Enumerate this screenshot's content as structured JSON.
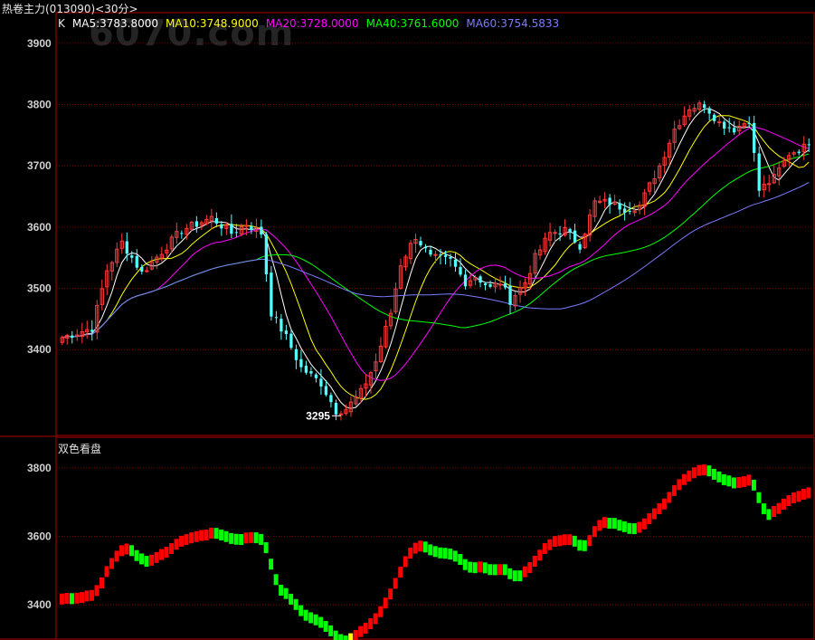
{
  "header": {
    "title": "热卷主力(013090)<30分>"
  },
  "watermark": "6070.com",
  "legend": [
    {
      "label": "K",
      "color": "#e8e8e8"
    },
    {
      "label": "MA5:3783.8000",
      "color": "#ffffff"
    },
    {
      "label": "MA10:3748.9000",
      "color": "#ffff00"
    },
    {
      "label": "MA20:3728.0000",
      "color": "#ff00ff"
    },
    {
      "label": "MA40:3761.6000",
      "color": "#00ff00"
    },
    {
      "label": "MA60:3754.5833",
      "color": "#7b7bff"
    }
  ],
  "sub_panel": {
    "title": "双色看盘"
  },
  "colors": {
    "up": "#ff3a3a",
    "down": "#54ffff",
    "grid": "#7a0000",
    "frame": "#b00000",
    "axis_text": "#d0d0d0",
    "bar_red": "#ff0000",
    "bar_green": "#00ff00",
    "bar_yellow": "#ffff00"
  },
  "chart_data": [
    {
      "type": "candlestick",
      "title": "热卷主力(013090)<30分>",
      "yticks": [
        3400,
        3500,
        3600,
        3700,
        3800,
        3900
      ],
      "ylim": [
        3260,
        3950
      ],
      "annotations": [
        {
          "text": "3295",
          "value": 3295
        }
      ],
      "grid": true,
      "close_anchors": [
        [
          0,
          3420
        ],
        [
          6,
          3435
        ],
        [
          9,
          3530
        ],
        [
          12,
          3575
        ],
        [
          16,
          3525
        ],
        [
          20,
          3560
        ],
        [
          24,
          3595
        ],
        [
          30,
          3615
        ],
        [
          34,
          3590
        ],
        [
          37,
          3605
        ],
        [
          40,
          3590
        ],
        [
          42,
          3460
        ],
        [
          45,
          3420
        ],
        [
          48,
          3370
        ],
        [
          52,
          3345
        ],
        [
          55,
          3300
        ],
        [
          57,
          3303
        ],
        [
          60,
          3330
        ],
        [
          63,
          3380
        ],
        [
          66,
          3460
        ],
        [
          68,
          3540
        ],
        [
          71,
          3585
        ],
        [
          74,
          3550
        ],
        [
          78,
          3545
        ],
        [
          81,
          3510
        ],
        [
          83,
          3520
        ],
        [
          86,
          3500
        ],
        [
          88,
          3510
        ],
        [
          90,
          3480
        ],
        [
          93,
          3510
        ],
        [
          95,
          3550
        ],
        [
          98,
          3590
        ],
        [
          101,
          3595
        ],
        [
          104,
          3570
        ],
        [
          107,
          3640
        ],
        [
          110,
          3640
        ],
        [
          113,
          3630
        ],
        [
          116,
          3635
        ],
        [
          120,
          3700
        ],
        [
          123,
          3760
        ],
        [
          126,
          3795
        ],
        [
          129,
          3800
        ],
        [
          132,
          3770
        ],
        [
          135,
          3760
        ],
        [
          138,
          3775
        ],
        [
          140,
          3660
        ],
        [
          143,
          3680
        ],
        [
          146,
          3720
        ],
        [
          149,
          3730
        ],
        [
          150,
          3740
        ]
      ],
      "series": [
        {
          "name": "MA5",
          "period": 5,
          "color": "#ffffff",
          "last": 3783.8
        },
        {
          "name": "MA10",
          "period": 10,
          "color": "#ffff00",
          "last": 3748.9
        },
        {
          "name": "MA20",
          "period": 20,
          "color": "#ff00ff",
          "last": 3728.0
        },
        {
          "name": "MA40",
          "period": 40,
          "color": "#00ff00",
          "last": 3761.6
        },
        {
          "name": "MA60",
          "period": 60,
          "color": "#7b7bff",
          "last": 3754.5833
        }
      ]
    },
    {
      "type": "bar",
      "title": "双色看盘",
      "yticks": [
        3400,
        3600,
        3800
      ],
      "ylim": [
        3300,
        3890
      ],
      "grid": true,
      "note": "two-color step bars following price; red when rising, green when falling, yellow at turning point"
    }
  ]
}
